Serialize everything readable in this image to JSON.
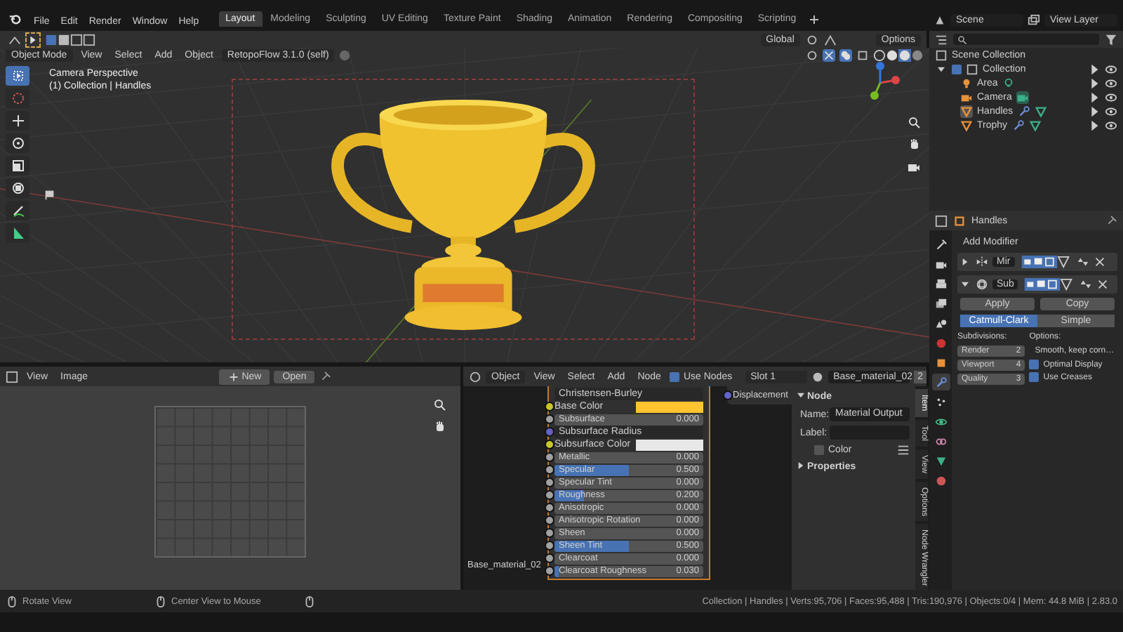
{
  "top_bar": {
    "menus": [
      "File",
      "Edit",
      "Render",
      "Window",
      "Help"
    ],
    "workspaces": [
      {
        "label": "Layout",
        "selected": true
      },
      {
        "label": "Modeling",
        "selected": false
      },
      {
        "label": "Sculpting",
        "selected": false
      },
      {
        "label": "UV Editing",
        "selected": false
      },
      {
        "label": "Texture Paint",
        "selected": false
      },
      {
        "label": "Shading",
        "selected": false
      },
      {
        "label": "Animation",
        "selected": false
      },
      {
        "label": "Rendering",
        "selected": false
      },
      {
        "label": "Compositing",
        "selected": false
      },
      {
        "label": "Scripting",
        "selected": false
      }
    ],
    "scene": "Scene",
    "view_layer": "View Layer"
  },
  "viewport": {
    "orientation": "Global",
    "options": "Options",
    "mode": "Object Mode",
    "menus": [
      "View",
      "Select",
      "Add",
      "Object"
    ],
    "addon": "RetopoFlow 3.1.0 (self)",
    "overlay_text": [
      "Camera Perspective",
      "(1) Collection | Handles"
    ],
    "tools": [
      {
        "kind": "select",
        "selected": true
      },
      {
        "kind": "cursor",
        "selected": false
      },
      {
        "kind": "move",
        "selected": false
      },
      {
        "kind": "rotate",
        "selected": false
      },
      {
        "kind": "scale",
        "selected": false
      },
      {
        "kind": "transform",
        "selected": false
      },
      {
        "kind": "annotate",
        "selected": false
      },
      {
        "kind": "measure",
        "selected": false
      }
    ]
  },
  "outliner": {
    "root": "Scene Collection",
    "collections": [
      {
        "label": "Collection",
        "checked": true,
        "expanded": true,
        "children": [
          {
            "label": "Area",
            "kind": "light",
            "selected": false
          },
          {
            "label": "Camera",
            "kind": "camera",
            "selected": false
          },
          {
            "label": "Handles",
            "kind": "mesh",
            "selected": true
          },
          {
            "label": "Trophy",
            "kind": "mesh",
            "selected": false
          }
        ]
      }
    ]
  },
  "properties": {
    "object_name": "Handles",
    "add_modifier": "Add Modifier",
    "tabs": [
      {
        "kind": "tool",
        "selected": false
      },
      {
        "kind": "render",
        "selected": false
      },
      {
        "kind": "output",
        "selected": false
      },
      {
        "kind": "view_layer",
        "selected": false
      },
      {
        "kind": "scene",
        "selected": false
      },
      {
        "kind": "world",
        "selected": false
      },
      {
        "kind": "object",
        "selected": false
      },
      {
        "kind": "modifier",
        "selected": true
      },
      {
        "kind": "particles",
        "selected": false
      },
      {
        "kind": "physics",
        "selected": false
      },
      {
        "kind": "constraints",
        "selected": false
      },
      {
        "kind": "data",
        "selected": false
      },
      {
        "kind": "material",
        "selected": false
      }
    ],
    "modifiers": [
      {
        "name": "Mir",
        "kind": "mirror",
        "expanded": false
      },
      {
        "name": "Sub",
        "kind": "subdivision",
        "expanded": true
      }
    ],
    "actions": [
      "Apply",
      "Copy"
    ],
    "types": [
      {
        "label": "Catmull-Clark",
        "selected": true
      },
      {
        "label": "Simple",
        "selected": false
      }
    ],
    "subdivisions_label": "Subdivisions:",
    "options_label": "Options:",
    "levels": [
      {
        "label": "Render",
        "value": "2"
      },
      {
        "label": "Viewport",
        "value": "4"
      },
      {
        "label": "Quality",
        "value": "3"
      }
    ],
    "uv_smooth": "Smooth, keep corn…",
    "checks": [
      {
        "label": "Optimal Display",
        "checked": true
      },
      {
        "label": "Use Creases",
        "checked": true
      }
    ]
  },
  "image_editor": {
    "menus": [
      "View",
      "Image"
    ],
    "new": "New",
    "open": "Open"
  },
  "node_editor": {
    "type": "Object",
    "menus": [
      "View",
      "Select",
      "Add",
      "Node"
    ],
    "use_nodes": {
      "label": "Use Nodes",
      "checked": true
    },
    "slot": "Slot 1",
    "material": "Base_material_02",
    "users": "2",
    "frame_label": "Base_material_02",
    "bsdf_rows": [
      {
        "kind": "menu",
        "label": "Christensen-Burley"
      },
      {
        "kind": "color",
        "label": "Base Color",
        "color": "#ffc42e"
      },
      {
        "kind": "value",
        "label": "Subsurface",
        "value": "0.000",
        "level": 0
      },
      {
        "kind": "vector",
        "label": "Subsurface Radius"
      },
      {
        "kind": "color",
        "label": "Subsurface Color",
        "color": "#e8e8e8"
      },
      {
        "kind": "value",
        "label": "Metallic",
        "value": "0.000",
        "level": 0
      },
      {
        "kind": "value",
        "label": "Specular",
        "value": "0.500",
        "level": 0.5
      },
      {
        "kind": "value",
        "label": "Specular Tint",
        "value": "0.000",
        "level": 0
      },
      {
        "kind": "value",
        "label": "Roughness",
        "value": "0.200",
        "level": 0.2
      },
      {
        "kind": "value",
        "label": "Anisotropic",
        "value": "0.000",
        "level": 0
      },
      {
        "kind": "value",
        "label": "Anisotropic Rotation",
        "value": "0.000",
        "level": 0
      },
      {
        "kind": "value",
        "label": "Sheen",
        "value": "0.000",
        "level": 0
      },
      {
        "kind": "value",
        "label": "Sheen Tint",
        "value": "0.500",
        "level": 0.5
      },
      {
        "kind": "value",
        "label": "Clearcoat",
        "value": "0.000",
        "level": 0
      },
      {
        "kind": "value",
        "label": "Clearcoat Roughness",
        "value": "0.030",
        "level": 0.03
      }
    ],
    "output_socket": "Displacement",
    "sidebar": {
      "panel": {
        "label": "Node",
        "expanded": true
      },
      "name_label": "Name:",
      "name_value": "Material Output",
      "label_label": "Label:",
      "color": {
        "label": "Color",
        "checked": false
      },
      "properties": {
        "label": "Properties",
        "expanded": false
      },
      "tabs": [
        {
          "label": "Item",
          "selected": true
        },
        {
          "label": "Tool",
          "selected": false
        },
        {
          "label": "View",
          "selected": false
        },
        {
          "label": "Options",
          "selected": false
        },
        {
          "label": "Node Wrangler",
          "selected": false
        }
      ]
    }
  },
  "status_bar": {
    "hints": [
      "Rotate View",
      "Center View to Mouse"
    ],
    "stats": "Collection | Handles | Verts:95,706 | Faces:95,488 | Tris:190,976 | Objects:0/4 | Mem: 44.8 MiB | 2.83.0"
  }
}
